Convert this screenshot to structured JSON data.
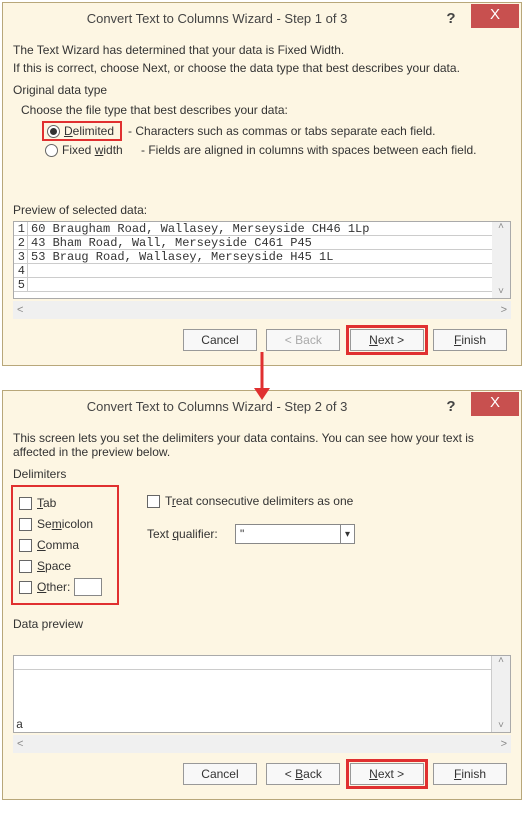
{
  "dialog1": {
    "title": "Convert Text to Columns Wizard - Step 1 of 3",
    "help_glyph": "?",
    "close_glyph": "X",
    "intro1": "The Text Wizard has determined that your data is Fixed Width.",
    "intro2": "If this is correct, choose Next, or choose the data type that best describes your data.",
    "orig_label": "Original data type",
    "choose_label": "Choose the file type that best describes your data:",
    "options": {
      "delimited": {
        "label": "Delimited",
        "desc": "- Characters such as commas or tabs separate each field."
      },
      "fixed": {
        "label": "Fixed width",
        "desc": "- Fields are aligned in columns with spaces between each field."
      }
    },
    "preview_label": "Preview of selected data:",
    "preview_rows": [
      "60 Braugham Road, Wallasey, Merseyside CH46 1Lp",
      "43 Bham Road, Wall, Merseyside C461 P45",
      "53 Braug Road, Wallasey, Merseyside H45 1L",
      "",
      ""
    ],
    "scroll_up": "˄",
    "scroll_down": "˅",
    "hs_left": "<",
    "hs_right": ">",
    "buttons": {
      "cancel": "Cancel",
      "back": "< Back",
      "next": "Next >",
      "finish": "Finish"
    }
  },
  "dialog2": {
    "title": "Convert Text to Columns Wizard - Step 2 of 3",
    "help_glyph": "?",
    "close_glyph": "X",
    "intro": "This screen lets you set the delimiters your data contains.  You can see how your text is affected in the preview below.",
    "delim_label": "Delimiters",
    "checks": {
      "tab": "Tab",
      "semicolon": "Semicolon",
      "comma": "Comma",
      "space": "Space",
      "other": "Other:"
    },
    "treat_label": "Treat consecutive delimiters as one",
    "qual_label": "Text qualifier:",
    "qual_value": "\"",
    "dd_glyph": "▾",
    "preview_label": "Data preview",
    "preview_val": "a",
    "scroll_up": "˄",
    "scroll_down": "˅",
    "hs_left": "<",
    "hs_right": ">",
    "buttons": {
      "cancel": "Cancel",
      "back": "< Back",
      "next": "Next >",
      "finish": "Finish"
    }
  }
}
